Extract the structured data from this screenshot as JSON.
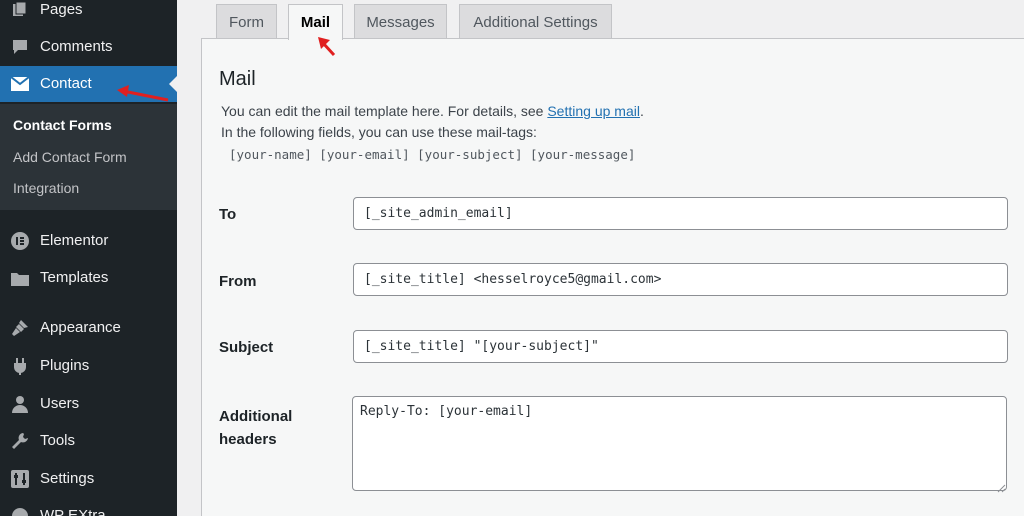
{
  "sidebar": {
    "items": [
      {
        "label": "Pages",
        "icon": "pages-icon"
      },
      {
        "label": "Comments",
        "icon": "comments-icon"
      },
      {
        "label": "Contact",
        "icon": "mail-icon"
      },
      {
        "label": "Elementor",
        "icon": "elementor-icon"
      },
      {
        "label": "Templates",
        "icon": "folder-icon"
      },
      {
        "label": "Appearance",
        "icon": "brush-icon"
      },
      {
        "label": "Plugins",
        "icon": "plug-icon"
      },
      {
        "label": "Users",
        "icon": "user-icon"
      },
      {
        "label": "Tools",
        "icon": "wrench-icon"
      },
      {
        "label": "Settings",
        "icon": "settings-icon"
      },
      {
        "label": "WP EXtra",
        "icon": "extra-icon"
      }
    ],
    "submenu": [
      {
        "label": "Contact Forms",
        "current": true
      },
      {
        "label": "Add Contact Form",
        "current": false
      },
      {
        "label": "Integration",
        "current": false
      }
    ]
  },
  "tabs": [
    "Form",
    "Mail",
    "Messages",
    "Additional Settings"
  ],
  "active_tab": "Mail",
  "mail": {
    "heading": "Mail",
    "desc_prefix": "You can edit the mail template here. For details, see ",
    "desc_link": "Setting up mail",
    "desc_suffix": ".",
    "desc_line2": "In the following fields, you can use these mail-tags:",
    "mail_tags": "[your-name] [your-email] [your-subject] [your-message]"
  },
  "fields": {
    "to": {
      "label": "To",
      "value": "[_site_admin_email]"
    },
    "from": {
      "label": "From",
      "value": "[_site_title] <hesselroyce5@gmail.com>"
    },
    "subject": {
      "label": "Subject",
      "value": "[_site_title] \"[your-subject]\""
    },
    "additional_headers": {
      "label_line1": "Additional",
      "label_line2": "headers",
      "value": "Reply-To: [your-email]"
    }
  },
  "colors": {
    "sidebar_bg": "#1d2327",
    "accent": "#2271b1",
    "annotation_arrow": "#e02020"
  }
}
